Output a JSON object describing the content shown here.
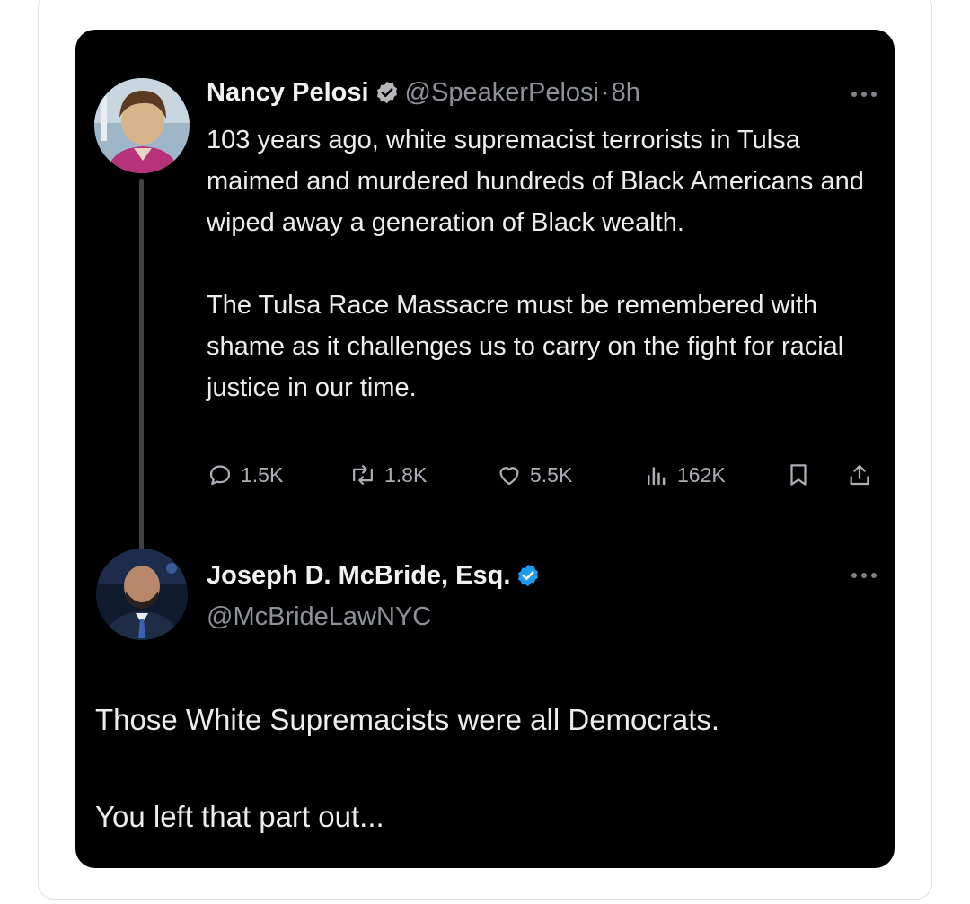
{
  "tweet": {
    "author_name": "Nancy Pelosi",
    "handle": "@SpeakerPelosi",
    "separator": "·",
    "time": "8h",
    "paragraph1": "103 years ago, white supremacist terrorists in Tulsa maimed and murdered hundreds of Black Americans and wiped away a generation of Black wealth.",
    "paragraph2": "The Tulsa Race Massacre must be remembered with shame as it challenges us to carry on the fight for racial justice in our time.",
    "stats": {
      "replies": "1.5K",
      "reposts": "1.8K",
      "likes": "5.5K",
      "views": "162K"
    },
    "verified_badge_color": "#b5b8bb"
  },
  "reply": {
    "author_name": "Joseph D. McBride, Esq.",
    "handle": "@McBrideLawNYC",
    "line1": "Those White Supremacists were all Democrats.",
    "line2": "You left that part out...",
    "verified_badge_color": "#1d9bf0"
  },
  "icons": [
    "verified-badge-icon",
    "more-icon",
    "reply-icon",
    "repost-icon",
    "like-icon",
    "views-icon",
    "bookmark-icon",
    "share-icon"
  ],
  "colors": {
    "background": "#000000",
    "text": "#e7e9ea",
    "muted": "#8b9299",
    "page": "#ffffff"
  }
}
